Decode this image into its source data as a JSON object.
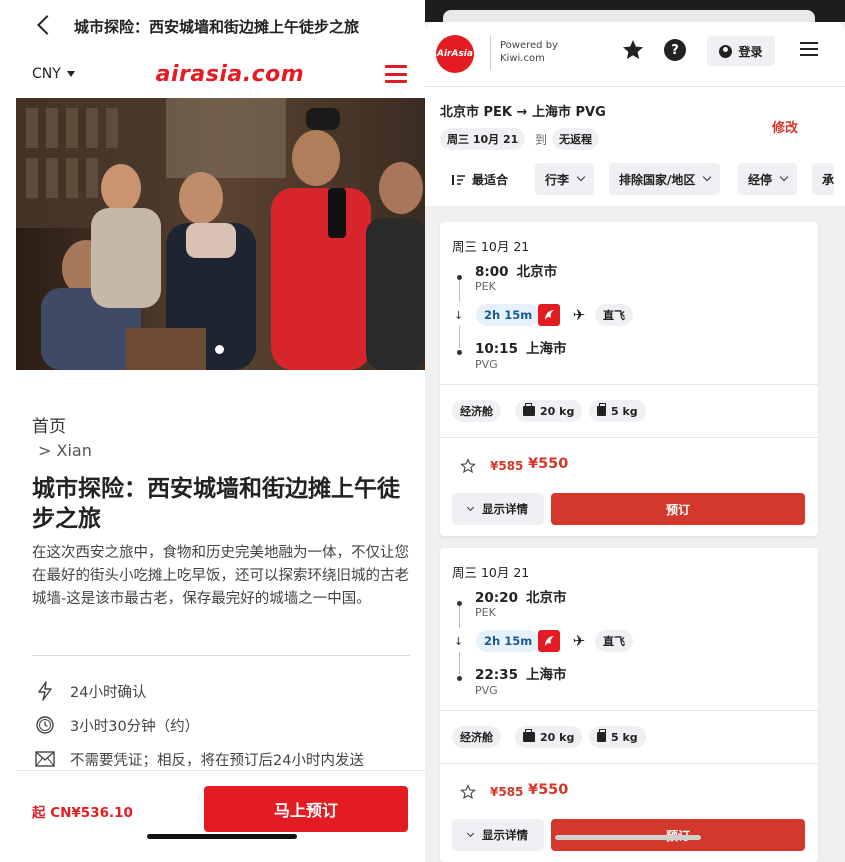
{
  "left": {
    "title": "城市探险：西安城墙和街边摊上午徒步之旅",
    "currency": "CNY",
    "logo": "airasia.com",
    "breadcrumb_home": "首页",
    "breadcrumb_city": "> Xian",
    "heading": "城市探险：西安城墙和街边摊上午徒步之旅",
    "description": "在这次西安之旅中，食物和历史完美地融为一体，不仅让您在最好的街头小吃摊上吃早饭，还可以探索环绕旧城的古老城墙-这是该市最古老，保存最完好的城墙之一中国。",
    "features": [
      {
        "icon": "lightning-icon",
        "text": "24小时确认"
      },
      {
        "icon": "clock-icon",
        "text": "3小时30分钟（约）"
      },
      {
        "icon": "envelope-icon",
        "text": "不需要凭证；相反，将在预订后24小时内发送"
      }
    ],
    "price": "起 CN¥536.10",
    "book_label": "马上预订",
    "colors": {
      "brand": "#e31c23"
    }
  },
  "right": {
    "header": {
      "logo_text": "AirAsia",
      "powered_line1": "Powered by",
      "powered_line2": "Kiwi.com",
      "help": "?",
      "login": "登录"
    },
    "search": {
      "route": "北京市 PEK → 上海市 PVG",
      "edit": "修改",
      "date": "周三 10月 21",
      "to": "到",
      "return": "无返程",
      "sort": "最适合",
      "filters": [
        "行李",
        "排除国家/地区",
        "经停",
        "承"
      ]
    },
    "flights": [
      {
        "date": "周三 10月 21",
        "dep_time": "8:00",
        "dep_city": "北京市",
        "dep_code": "PEK",
        "duration": "2h 15m",
        "direct": "直飞",
        "arr_time": "10:15",
        "arr_city": "上海市",
        "arr_code": "PVG",
        "cabin": "经济舱",
        "checked_bag": "20 kg",
        "cabin_bag": "5 kg",
        "old_price": "¥585",
        "price": "¥550",
        "details": "显示详情",
        "book": "预订"
      },
      {
        "date": "周三 10月 21",
        "dep_time": "20:20",
        "dep_city": "北京市",
        "dep_code": "PEK",
        "duration": "2h 15m",
        "direct": "直飞",
        "arr_time": "22:35",
        "arr_city": "上海市",
        "arr_code": "PVG",
        "cabin": "经济舱",
        "checked_bag": "20 kg",
        "cabin_bag": "5 kg",
        "old_price": "¥585",
        "price": "¥550",
        "details": "显示详情",
        "book": "预订"
      }
    ],
    "colors": {
      "accent": "#d2392b",
      "duration_bg": "#e6f1fb",
      "airline": "#e31c23"
    }
  }
}
